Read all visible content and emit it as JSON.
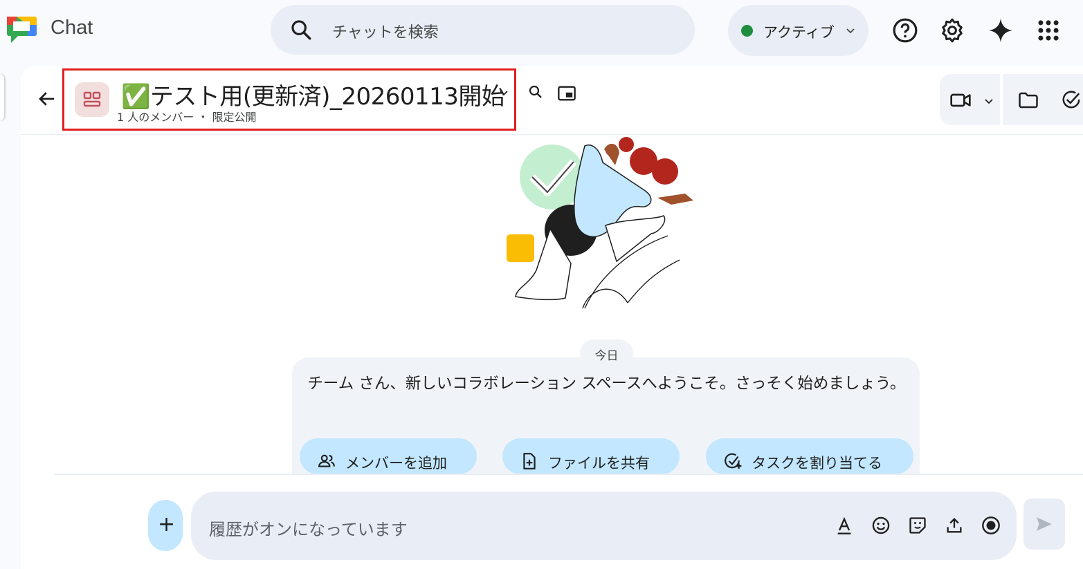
{
  "app": {
    "name": "Chat"
  },
  "search": {
    "placeholder": "チャットを検索"
  },
  "status": {
    "label": "アクティブ",
    "color": "#1e8e3e"
  },
  "topbar": {
    "icons": [
      "help-icon",
      "settings-icon",
      "gemini-icon",
      "apps-grid-icon"
    ]
  },
  "space": {
    "title": "✅テスト用(更新済)_20260113開始",
    "subtitle": "1 人のメンバー ・ 限定公開"
  },
  "header": {
    "icons": [
      "search-in-space-icon",
      "picture-in-picture-icon",
      "video-call-icon",
      "files-icon",
      "tasks-icon"
    ]
  },
  "welcome": {
    "date": "今日",
    "message": "チーム さん、新しいコラボレーション スペースへようこそ。さっそく始めましょう。",
    "actions": [
      {
        "label": "メンバーを追加",
        "icon": "add-people-icon"
      },
      {
        "label": "ファイルを共有",
        "icon": "share-file-icon"
      },
      {
        "label": "タスクを割り当てる",
        "icon": "assign-task-icon"
      }
    ]
  },
  "composer": {
    "placeholder": "履歴がオンになっています",
    "icons": [
      "format-text-icon",
      "emoji-icon",
      "sticker-icon",
      "upload-icon",
      "record-icon",
      "send-icon"
    ]
  },
  "colors": {
    "highlight": "#e01e1e",
    "chip": "#c2e7ff",
    "panel_bg": "#f8fafd"
  }
}
